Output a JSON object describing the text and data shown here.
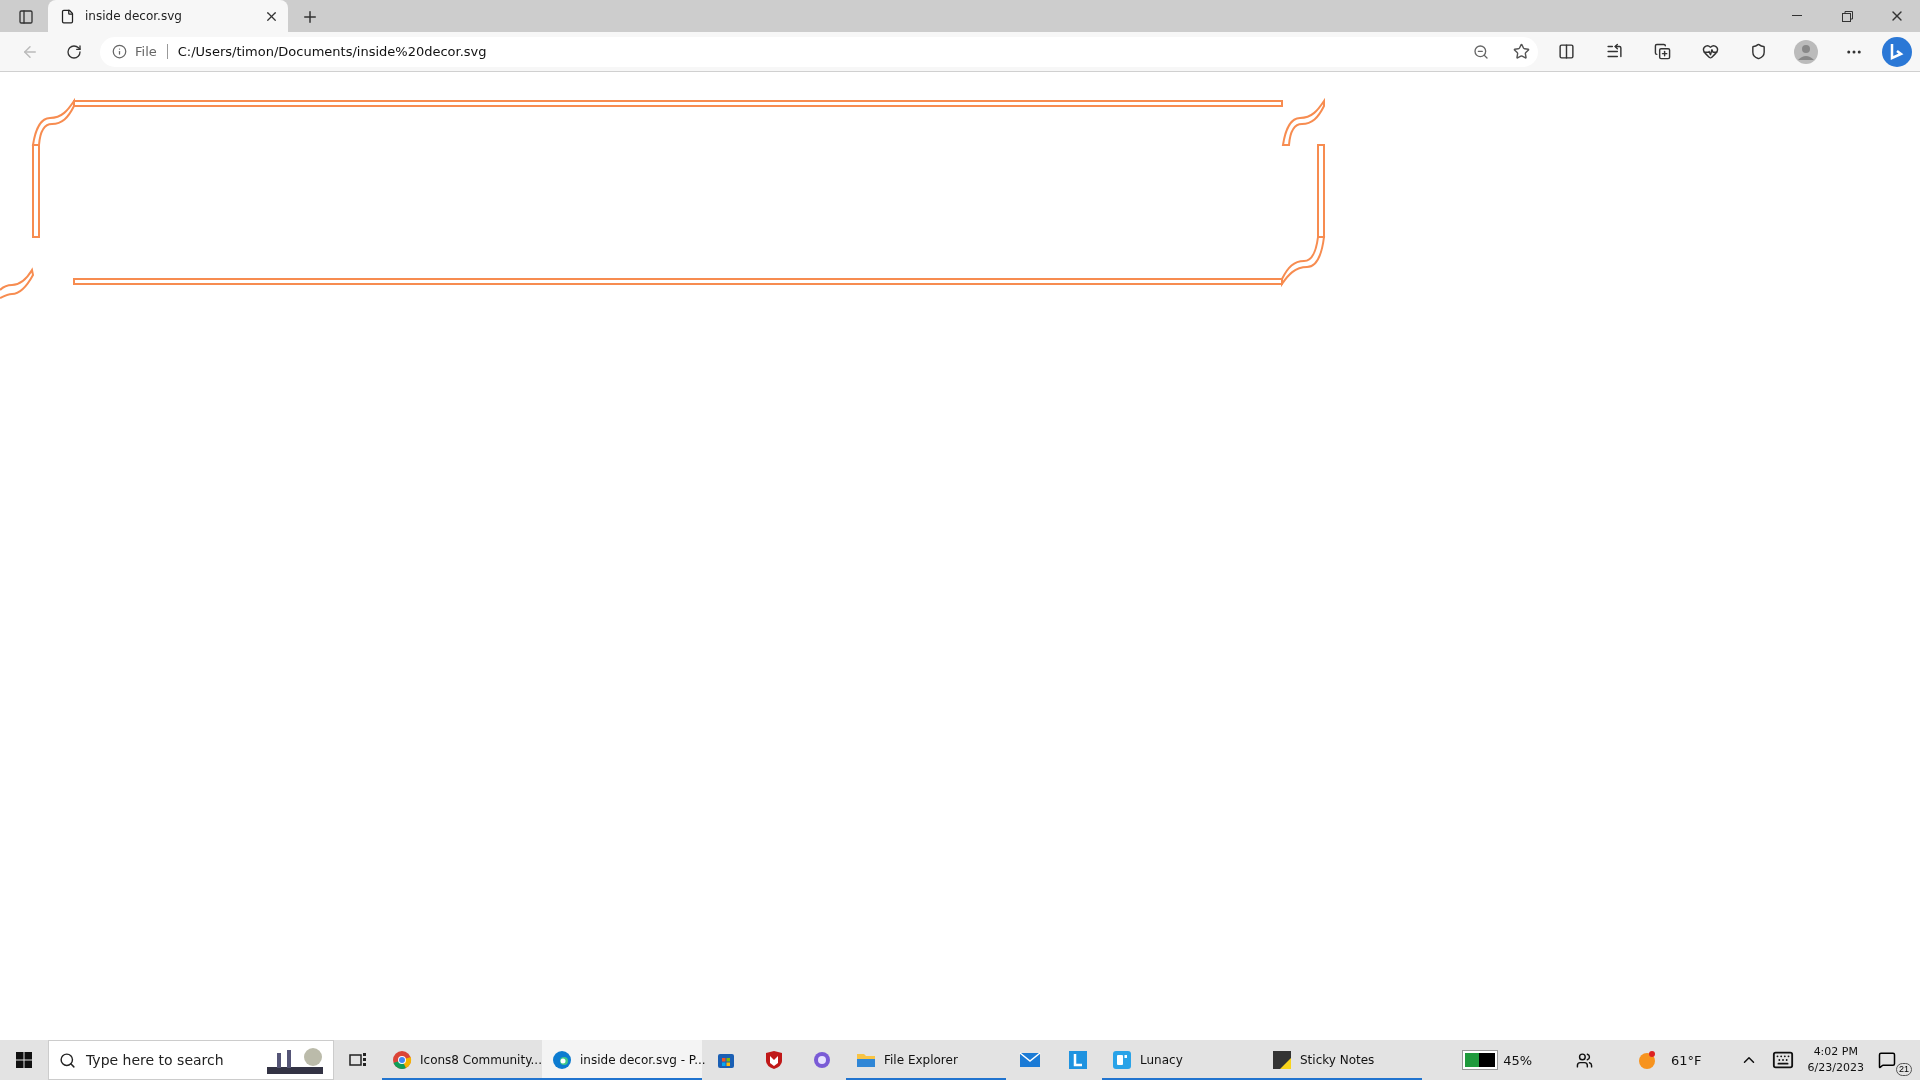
{
  "tab": {
    "title": "inside decor.svg",
    "selected": true
  },
  "address": {
    "scheme": "File",
    "url": "C:/Users/timon/Documents/inside%20decor.svg"
  },
  "taskbar": {
    "search": {
      "placeholder": "Type here to search"
    },
    "apps": [
      {
        "kind": "chrome",
        "label": "Icons8 Community...",
        "running": true,
        "selected": false
      },
      {
        "kind": "edge",
        "label": "inside decor.svg - P...",
        "running": true,
        "selected": true
      },
      {
        "kind": "store",
        "running": false,
        "selected": false
      },
      {
        "kind": "shield",
        "running": false,
        "selected": false
      },
      {
        "kind": "orb",
        "running": false,
        "selected": false
      },
      {
        "kind": "folder",
        "label": "File Explorer",
        "running": true,
        "selected": false
      },
      {
        "kind": "mail",
        "running": false,
        "selected": false
      },
      {
        "kind": "letter",
        "running": false,
        "selected": false
      },
      {
        "kind": "lunacy",
        "label": "Lunacy",
        "running": true,
        "selected": false
      },
      {
        "kind": "notes",
        "label": "Sticky Notes",
        "running": true,
        "selected": false
      }
    ],
    "battery": {
      "reading": "45%",
      "level": 0.45
    },
    "weather": "61°F",
    "time": "4:02 PM",
    "date": "6/23/2023",
    "notifications": "21"
  }
}
